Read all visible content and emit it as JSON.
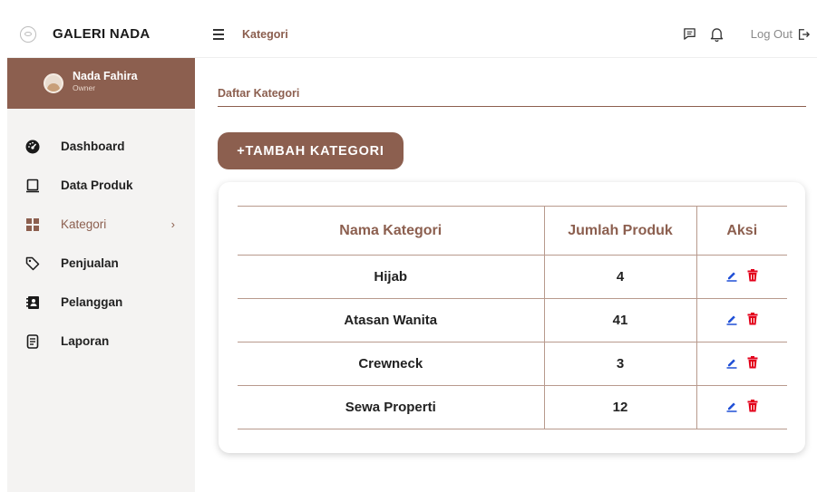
{
  "app": {
    "brand": "GALERI NADA"
  },
  "header": {
    "breadcrumb": "Kategori",
    "logout_label": "Log Out"
  },
  "user": {
    "name": "Nada Fahira",
    "role": "Owner"
  },
  "sidebar": {
    "items": [
      {
        "label": "Dashboard",
        "icon": "dashboard-icon"
      },
      {
        "label": "Data Produk",
        "icon": "laptop-icon"
      },
      {
        "label": "Kategori",
        "icon": "grid-icon",
        "active": true
      },
      {
        "label": "Penjualan",
        "icon": "tag-icon"
      },
      {
        "label": "Pelanggan",
        "icon": "contact-book-icon"
      },
      {
        "label": "Laporan",
        "icon": "report-icon"
      }
    ]
  },
  "main": {
    "section_title": "Daftar Kategori",
    "add_button": "+TAMBAH KATEGORI",
    "table": {
      "headers": [
        "Nama Kategori",
        "Jumlah Produk",
        "Aksi"
      ],
      "rows": [
        {
          "name": "Hijab",
          "count": "4"
        },
        {
          "name": "Atasan Wanita",
          "count": "41"
        },
        {
          "name": "Crewneck",
          "count": "3"
        },
        {
          "name": "Sewa Properti",
          "count": "12"
        }
      ]
    }
  },
  "colors": {
    "accent": "#8c5f4f",
    "edit": "#1f4fd6",
    "delete": "#e3001b",
    "sidebar_bg": "#f4f3f2"
  }
}
